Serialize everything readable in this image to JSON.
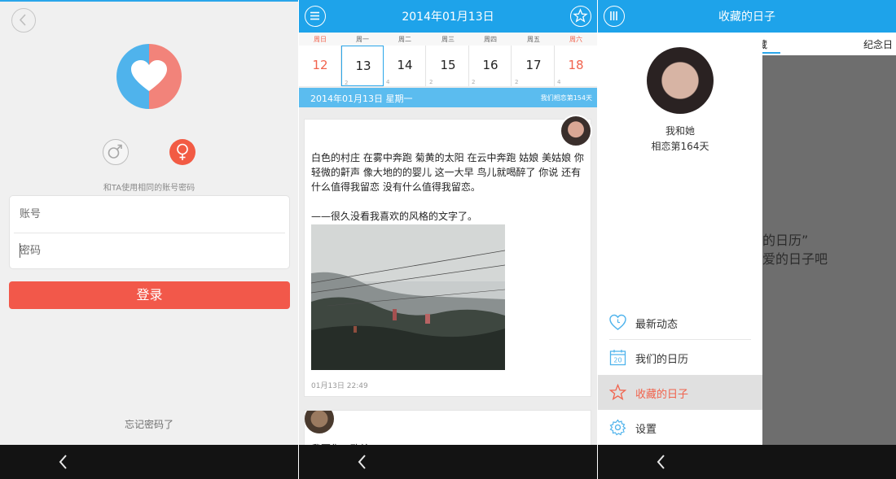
{
  "login": {
    "hint": "和TA使用相同的账号密码",
    "account_placeholder": "账号",
    "password_placeholder": "密码",
    "login_label": "登录",
    "forgot_label": "忘记密码了",
    "colors": {
      "primary": "#f2584a",
      "logo_left": "#4fb3ec",
      "logo_right": "#f2837a"
    }
  },
  "calendar": {
    "title": "2014年01月13日",
    "weekdays": [
      "周日",
      "周一",
      "周二",
      "周三",
      "周四",
      "周五",
      "周六"
    ],
    "days": [
      {
        "num": "12",
        "count": ""
      },
      {
        "num": "13",
        "count": "2"
      },
      {
        "num": "14",
        "count": "4"
      },
      {
        "num": "15",
        "count": "2"
      },
      {
        "num": "16",
        "count": "2"
      },
      {
        "num": "17",
        "count": "2"
      },
      {
        "num": "18",
        "count": "4"
      }
    ],
    "subbar_date": "2014年01月13日 星期一",
    "subbar_love": "我们相恋第154天",
    "post": {
      "paragraph1": "白色的村庄 在雾中奔跑 菊黄的太阳 在云中奔跑 姑娘 美姑娘 你轻微的鼾声 像大地的的婴儿 这一大早 鸟儿就喝醉了 你说 还有什么值得我留恋 没有什么值得我留恋。",
      "paragraph2": "——很久没看我喜欢的风格的文字了。",
      "time": "01月13日 22:49"
    },
    "post2_cut": "我要你…致给"
  },
  "drawer": {
    "title": "收藏的日子",
    "name": "我和她",
    "days": "相恋第164天",
    "items": [
      {
        "label": "最新动态",
        "icon": "heart-clock-icon"
      },
      {
        "label": "我们的日历",
        "icon": "calendar-icon",
        "icon_text": "20"
      },
      {
        "label": "收藏的日子",
        "icon": "star-icon"
      },
      {
        "label": "设置",
        "icon": "gear-icon"
      }
    ],
    "behind_tab1": "藏",
    "behind_tab2": "纪念日",
    "behind_line1": "的日历”",
    "behind_line2": "爱的日子吧"
  }
}
